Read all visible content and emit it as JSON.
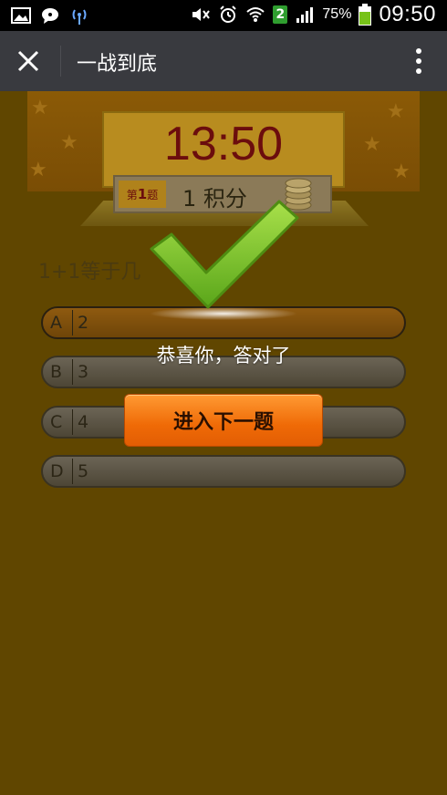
{
  "status_bar": {
    "battery_percent": "75%",
    "clock": "09:50",
    "sim_badge": "2",
    "icons": [
      "image-icon",
      "chat-bubble-icon",
      "broadcast-icon",
      "mute-icon",
      "alarm-icon",
      "wifi-icon",
      "signal-icon",
      "battery-icon"
    ]
  },
  "app_bar": {
    "title": "一战到底",
    "icons": [
      "close-icon",
      "more-vertical-icon"
    ]
  },
  "game": {
    "timer": "13:50",
    "question_number_prefix": "第",
    "question_number": "1",
    "question_number_suffix": "题",
    "score": "1 积分",
    "question": "1+1等于几",
    "options": [
      {
        "letter": "A",
        "value": "2",
        "selected": true
      },
      {
        "letter": "B",
        "value": "3",
        "selected": false
      },
      {
        "letter": "C",
        "value": "4",
        "selected": false
      },
      {
        "letter": "D",
        "value": "5",
        "selected": false
      }
    ]
  },
  "result_overlay": {
    "message": "恭喜你，答对了",
    "next_button_label": "进入下一题",
    "icon": "checkmark-icon"
  },
  "colors": {
    "status_bar_bg": "#000000",
    "app_bar_bg": "#393a3f",
    "page_bg": "#604600",
    "timer_text": "#6b0d0d",
    "checkmark": "#7cc42a",
    "next_button": "#ef6a06"
  }
}
